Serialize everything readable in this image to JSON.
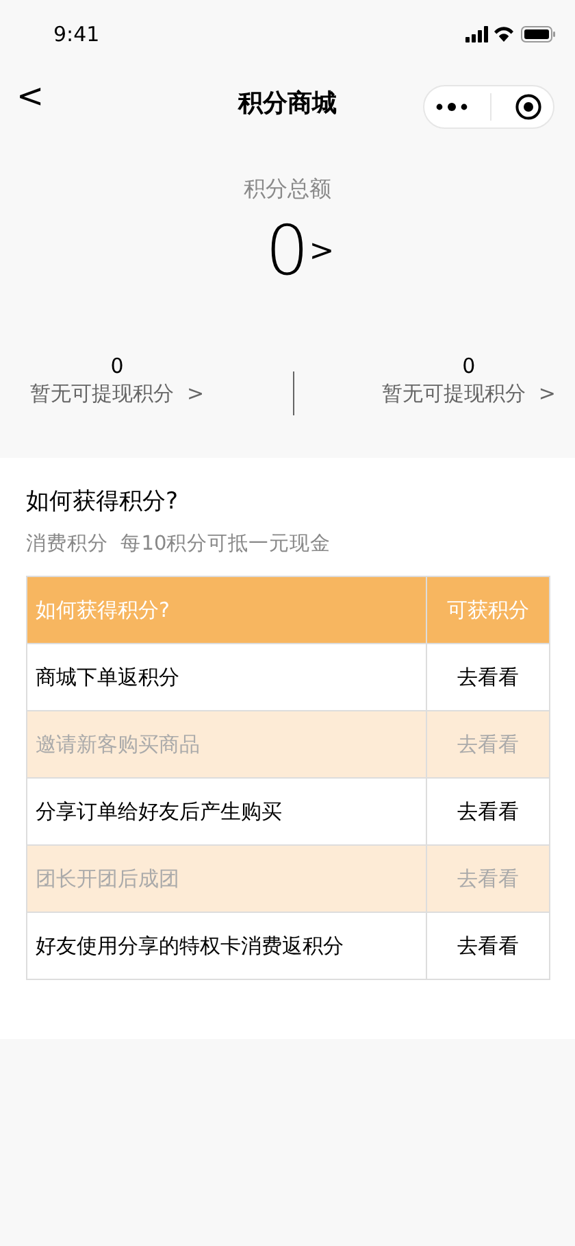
{
  "status_bar": {
    "time": "9:41"
  },
  "nav": {
    "back": "<",
    "title": "积分商城"
  },
  "summary": {
    "label": "积分总额",
    "total": "0",
    "chevron": ">"
  },
  "stats": [
    {
      "value": "0",
      "label": "暂无可提现积分",
      "chevron": ">"
    },
    {
      "value": "0",
      "label": "暂无可提现积分",
      "chevron": ">"
    }
  ],
  "section": {
    "title": "如何获得积分?",
    "subtitle": "消费积分  每10积分可抵一元现金"
  },
  "table": {
    "columns": [
      "如何获得积分?",
      "可获积分"
    ],
    "rows": [
      {
        "task": "商城下单返积分",
        "action": "去看看",
        "disabled": false
      },
      {
        "task": "邀请新客购买商品",
        "action": "去看看",
        "disabled": true
      },
      {
        "task": "分享订单给好友后产生购买",
        "action": "去看看",
        "disabled": false
      },
      {
        "task": "团长开团后成团",
        "action": "去看看",
        "disabled": true
      },
      {
        "task": "好友使用分享的特权卡消费返积分",
        "action": "去看看",
        "disabled": false
      }
    ]
  }
}
